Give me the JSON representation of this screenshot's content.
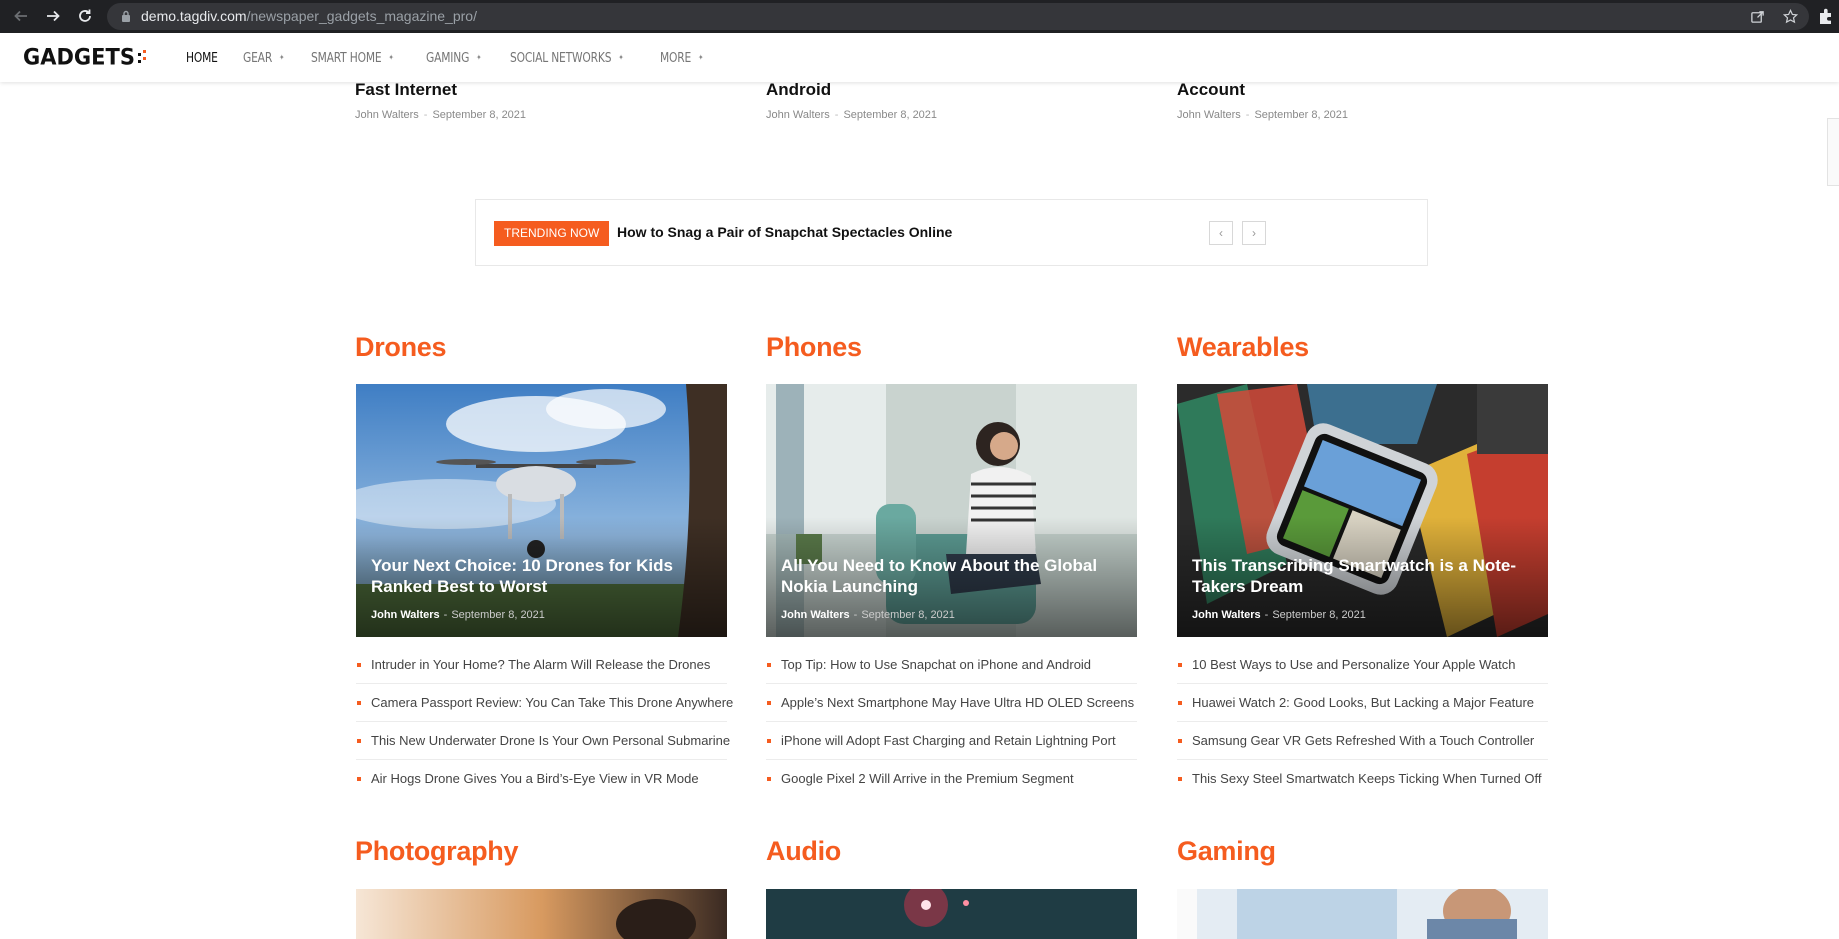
{
  "browser": {
    "url_host": "demo.tagdiv.com",
    "url_path": "/newspaper_gadgets_magazine_pro/"
  },
  "site": {
    "logo_text": "GADGETS",
    "nav": [
      {
        "label": "HOME",
        "active": true,
        "has_dropdown": false
      },
      {
        "label": "GEAR",
        "active": false,
        "has_dropdown": true
      },
      {
        "label": "SMART HOME",
        "active": false,
        "has_dropdown": true
      },
      {
        "label": "GAMING",
        "active": false,
        "has_dropdown": true
      },
      {
        "label": "SOCIAL NETWORKS",
        "active": false,
        "has_dropdown": true
      },
      {
        "label": "MORE",
        "active": false,
        "has_dropdown": true
      }
    ],
    "caret": "✦"
  },
  "top_articles": [
    {
      "title": "Fast Internet",
      "author": "John Walters",
      "sep": "-",
      "date": "September 8, 2021"
    },
    {
      "title": "Android",
      "author": "John Walters",
      "sep": "-",
      "date": "September 8, 2021"
    },
    {
      "title": "Account",
      "author": "John Walters",
      "sep": "-",
      "date": "September 8, 2021"
    }
  ],
  "trending": {
    "label": "TRENDING NOW",
    "title": "How to Snag a Pair of Snapchat Spectacles Online",
    "prev": "‹",
    "next": "›"
  },
  "categories": [
    {
      "name": "Drones",
      "feature": {
        "title": "Your Next Choice: 10 Drones for Kids Ranked Best to Worst",
        "author": "John Walters",
        "sep": "-",
        "date": "September 8, 2021"
      },
      "list": [
        "Intruder in Your Home? The Alarm Will Release the Drones",
        "Camera Passport Review: You Can Take This Drone Anywhere",
        "This New Underwater Drone Is Your Own Personal Submarine",
        "Air Hogs Drone Gives You a Bird’s-Eye View in VR Mode"
      ]
    },
    {
      "name": "Phones",
      "feature": {
        "title": "All You Need to Know About the Global Nokia Launching",
        "author": "John Walters",
        "sep": "-",
        "date": "September 8, 2021"
      },
      "list": [
        "Top Tip: How to Use Snapchat on iPhone and Android",
        "Apple’s Next Smartphone May Have Ultra HD OLED Screens",
        "iPhone will Adopt Fast Charging and Retain Lightning Port",
        "Google Pixel 2 Will Arrive in the Premium Segment"
      ]
    },
    {
      "name": "Wearables",
      "feature": {
        "title": "This Transcribing Smartwatch is a Note-Takers Dream",
        "author": "John Walters",
        "sep": "-",
        "date": "September 8, 2021"
      },
      "list": [
        "10 Best Ways to Use and Personalize Your Apple Watch",
        "Huawei Watch 2: Good Looks, But Lacking a Major Feature",
        "Samsung Gear VR Gets Refreshed With a Touch Controller",
        "This Sexy Steel Smartwatch Keeps Ticking When Turned Off"
      ]
    }
  ],
  "more_categories": [
    "Photography",
    "Audio",
    "Gaming"
  ],
  "colors": {
    "accent": "#f55c1f",
    "chrome": "#202124"
  }
}
